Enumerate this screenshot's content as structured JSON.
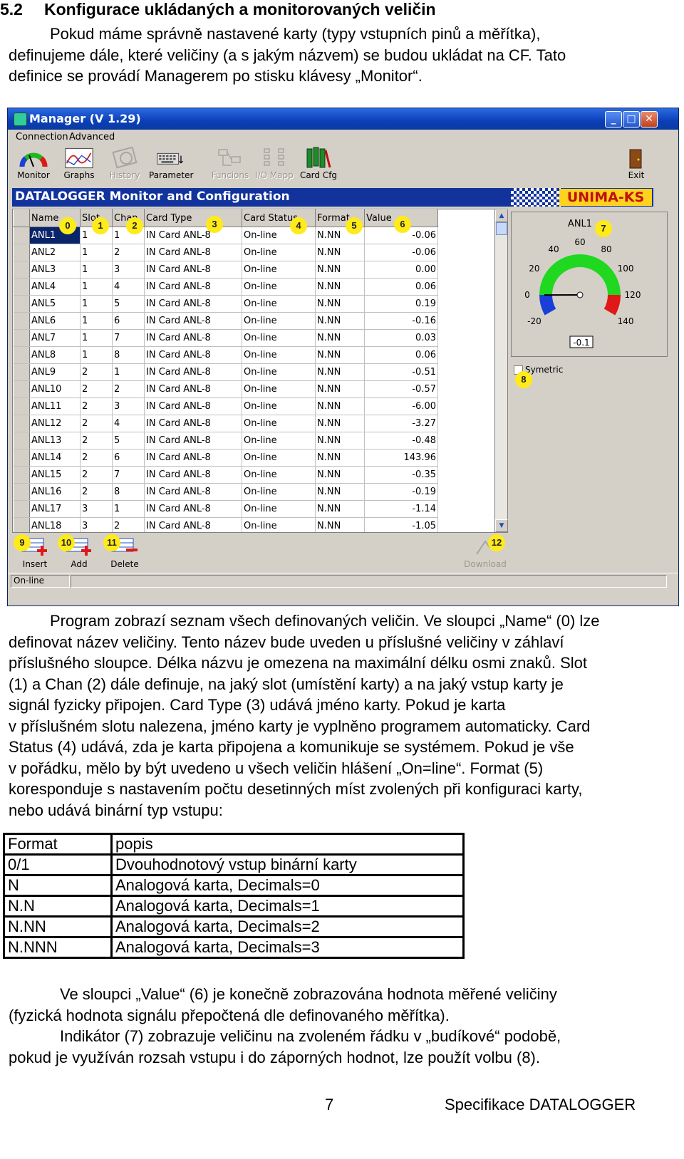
{
  "section": {
    "number": "5.2",
    "title": "Konfigurace ukládaných a monitorovaných veličin"
  },
  "intro": [
    "Pokud máme správně nastavené karty (typy vstupních pinů a měřítka),",
    "definujeme dále, které veličiny (a s jakým názvem)  se budou ukládat na CF. Tato",
    "definice se provádí Managerem po stisku klávesy „Monitor“."
  ],
  "window": {
    "title": "Manager (V 1.29)",
    "title_buttons": [
      "_",
      "□",
      "✕"
    ],
    "menu": [
      "Connection",
      "Advanced"
    ],
    "toolbar": [
      {
        "label": "Monitor",
        "icon": "gauge-icon",
        "enabled": true
      },
      {
        "label": "Graphs",
        "icon": "graph-icon",
        "enabled": true
      },
      {
        "label": "History",
        "icon": "history-icon",
        "enabled": false
      },
      {
        "label": "Parameter",
        "icon": "keyboard-icon",
        "enabled": true
      },
      {
        "label": "Funcions",
        "icon": "function-icon",
        "enabled": false
      },
      {
        "label": "I/O Mapp",
        "icon": "io-map-icon",
        "enabled": false
      },
      {
        "label": "Card Cfg",
        "icon": "card-config-icon",
        "enabled": true
      },
      {
        "label": "Exit",
        "icon": "exit-door-icon",
        "enabled": true
      }
    ],
    "banner_title": "DATALOGGER Monitor and Configuration",
    "logo": "UNIMA-KS",
    "columns": [
      "Name",
      "Slot",
      "Chan",
      "Card Type",
      "Card Status",
      "Format",
      "Value"
    ],
    "rows": [
      [
        "ANL1",
        "1",
        "1",
        "IN Card ANL-8",
        "On-line",
        "N.NN",
        "-0.06"
      ],
      [
        "ANL2",
        "1",
        "2",
        "IN Card ANL-8",
        "On-line",
        "N.NN",
        "-0.06"
      ],
      [
        "ANL3",
        "1",
        "3",
        "IN Card ANL-8",
        "On-line",
        "N.NN",
        "0.00"
      ],
      [
        "ANL4",
        "1",
        "4",
        "IN Card ANL-8",
        "On-line",
        "N.NN",
        "0.06"
      ],
      [
        "ANL5",
        "1",
        "5",
        "IN Card ANL-8",
        "On-line",
        "N.NN",
        "0.19"
      ],
      [
        "ANL6",
        "1",
        "6",
        "IN Card ANL-8",
        "On-line",
        "N.NN",
        "-0.16"
      ],
      [
        "ANL7",
        "1",
        "7",
        "IN Card ANL-8",
        "On-line",
        "N.NN",
        "0.03"
      ],
      [
        "ANL8",
        "1",
        "8",
        "IN Card ANL-8",
        "On-line",
        "N.NN",
        "0.06"
      ],
      [
        "ANL9",
        "2",
        "1",
        "IN Card ANL-8",
        "On-line",
        "N.NN",
        "-0.51"
      ],
      [
        "ANL10",
        "2",
        "2",
        "IN Card ANL-8",
        "On-line",
        "N.NN",
        "-0.57"
      ],
      [
        "ANL11",
        "2",
        "3",
        "IN Card ANL-8",
        "On-line",
        "N.NN",
        "-6.00"
      ],
      [
        "ANL12",
        "2",
        "4",
        "IN Card ANL-8",
        "On-line",
        "N.NN",
        "-3.27"
      ],
      [
        "ANL13",
        "2",
        "5",
        "IN Card ANL-8",
        "On-line",
        "N.NN",
        "-0.48"
      ],
      [
        "ANL14",
        "2",
        "6",
        "IN Card ANL-8",
        "On-line",
        "N.NN",
        "143.96"
      ],
      [
        "ANL15",
        "2",
        "7",
        "IN Card ANL-8",
        "On-line",
        "N.NN",
        "-0.35"
      ],
      [
        "ANL16",
        "2",
        "8",
        "IN Card ANL-8",
        "On-line",
        "N.NN",
        "-0.19"
      ],
      [
        "ANL17",
        "3",
        "1",
        "IN Card ANL-8",
        "On-line",
        "N.NN",
        "-1.14"
      ],
      [
        "ANL18",
        "3",
        "2",
        "IN Card ANL-8",
        "On-line",
        "N.NN",
        "-1.05"
      ]
    ],
    "selected_row": 0,
    "gauge": {
      "title": "ANL1",
      "ticks": [
        "-20",
        "0",
        "20",
        "40",
        "60",
        "80",
        "100",
        "120",
        "140"
      ],
      "value": -0.1,
      "readout": "-0.1",
      "min": -20,
      "max": 140,
      "colors": {
        "low": "#1a3fd8",
        "normal": "#1fd81f",
        "high": "#e01818"
      }
    },
    "symetric_label": "Symetric",
    "bottom_buttons": [
      {
        "label": "Insert",
        "icon": "insert-row-icon",
        "enabled": true
      },
      {
        "label": "Add",
        "icon": "add-row-icon",
        "enabled": true
      },
      {
        "label": "Delete",
        "icon": "delete-row-icon",
        "enabled": true
      },
      {
        "label": "Download",
        "icon": "download-icon",
        "enabled": false
      }
    ],
    "status": "On-line",
    "callouts": [
      "0",
      "1",
      "2",
      "3",
      "4",
      "5",
      "6",
      "7",
      "8",
      "9",
      "10",
      "11",
      "12"
    ]
  },
  "body_paragraph": [
    "Program zobrazí seznam všech definovaných veličin. Ve sloupci „Name“ (0) lze",
    "definovat název veličiny. Tento název bude uveden u příslušné veličiny v záhlaví",
    "příslušného sloupce. Délka názvu je omezena na maximální délku osmi znaků. Slot",
    "(1) a Chan (2) dále definuje, na jaký slot (umístění karty) a na jaký vstup karty je",
    "signál fyzicky připojen. Card Type (3) udává jméno karty. Pokud je karta",
    "v příslušném slotu nalezena, jméno karty je vyplněno programem automaticky. Card",
    "Status (4) udává, zda je karta připojena  a komunikuje se systémem. Pokud je vše",
    "v pořádku, mělo by být uvedeno u všech veličin hlášení „On=line“. Format (5)",
    "koresponduje s nastavením počtu desetinných míst zvolených při konfiguraci karty,",
    "nebo udává binární typ vstupu:"
  ],
  "format_table": {
    "header": [
      "Format",
      "popis"
    ],
    "rows": [
      [
        "0/1",
        "Dvouhodnotový vstup binární karty"
      ],
      [
        "N",
        "Analogová karta, Decimals=0"
      ],
      [
        "N.N",
        "Analogová karta, Decimals=1"
      ],
      [
        "N.NN",
        "Analogová karta, Decimals=2"
      ],
      [
        "N.NNN",
        "Analogová karta, Decimals=3"
      ]
    ]
  },
  "closing": [
    "Ve sloupci „Value“ (6) je konečně zobrazována hodnota měřené veličiny",
    "(fyzická hodnota signálu přepočtená dle definovaného měřítka).",
    "Indikátor (7) zobrazuje veličinu na zvoleném řádku v „budíkové“ podobě,",
    "pokud je využíván rozsah vstupu i do záporných hodnot, lze použít volbu (8)."
  ],
  "footer": {
    "page": "7",
    "doc_title": "Specifikace DATALOGGER"
  }
}
